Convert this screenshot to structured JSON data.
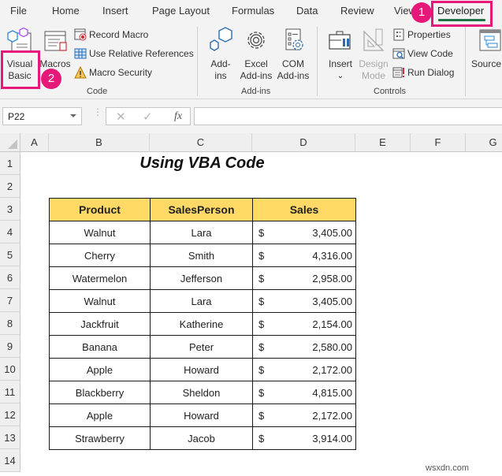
{
  "tabs": [
    "File",
    "Home",
    "Insert",
    "Page Layout",
    "Formulas",
    "Data",
    "Review",
    "View",
    "Developer"
  ],
  "active_tab": "Developer",
  "ribbon": {
    "code": {
      "label": "Code",
      "visual_basic": [
        "Visual",
        "Basic"
      ],
      "macros": "Macros",
      "record_macro": "Record Macro",
      "use_relative_references": "Use Relative References",
      "macro_security": "Macro Security"
    },
    "addins": {
      "label": "Add-ins",
      "addins": [
        "Add-",
        "ins"
      ],
      "excel_addins": [
        "Excel",
        "Add-ins"
      ],
      "com_addins": [
        "COM",
        "Add-ins"
      ]
    },
    "controls": {
      "label": "Controls",
      "insert": "Insert",
      "insert_arrow": "⌄",
      "design_mode": [
        "Design",
        "Mode"
      ],
      "properties": "Properties",
      "view_code": "View Code",
      "run_dialog": "Run Dialog"
    },
    "xml": {
      "source": "Source"
    }
  },
  "callouts": {
    "step1": "1",
    "step2": "2",
    "color": "#e6197a"
  },
  "formula_bar": {
    "name_box": "P22",
    "cancel": "✕",
    "enter": "✓",
    "fx": "fx",
    "formula": ""
  },
  "columns": [
    "A",
    "B",
    "C",
    "D",
    "E",
    "F",
    "G"
  ],
  "rows": [
    "1",
    "2",
    "3",
    "4",
    "5",
    "6",
    "7",
    "8",
    "9",
    "10",
    "11",
    "12",
    "13",
    "14"
  ],
  "sheet": {
    "title": "Using VBA Code",
    "header_fill": "#ffd966",
    "headers": [
      "Product",
      "SalesPerson",
      "Sales"
    ],
    "currency_symbol": "$",
    "records": [
      {
        "product": "Walnut",
        "salesperson": "Lara",
        "sales": "3,405.00"
      },
      {
        "product": "Cherry",
        "salesperson": "Smith",
        "sales": "4,316.00"
      },
      {
        "product": "Watermelon",
        "salesperson": "Jefferson",
        "sales": "2,958.00"
      },
      {
        "product": "Walnut",
        "salesperson": "Lara",
        "sales": "3,405.00"
      },
      {
        "product": "Jackfruit",
        "salesperson": "Katherine",
        "sales": "2,154.00"
      },
      {
        "product": "Banana",
        "salesperson": "Peter",
        "sales": "2,580.00"
      },
      {
        "product": "Apple",
        "salesperson": "Howard",
        "sales": "2,172.00"
      },
      {
        "product": "Blackberry",
        "salesperson": "Sheldon",
        "sales": "4,815.00"
      },
      {
        "product": "Apple",
        "salesperson": "Howard",
        "sales": "2,172.00"
      },
      {
        "product": "Strawberry",
        "salesperson": "Jacob",
        "sales": "3,914.00"
      }
    ]
  },
  "watermark": "wsxdn.com"
}
